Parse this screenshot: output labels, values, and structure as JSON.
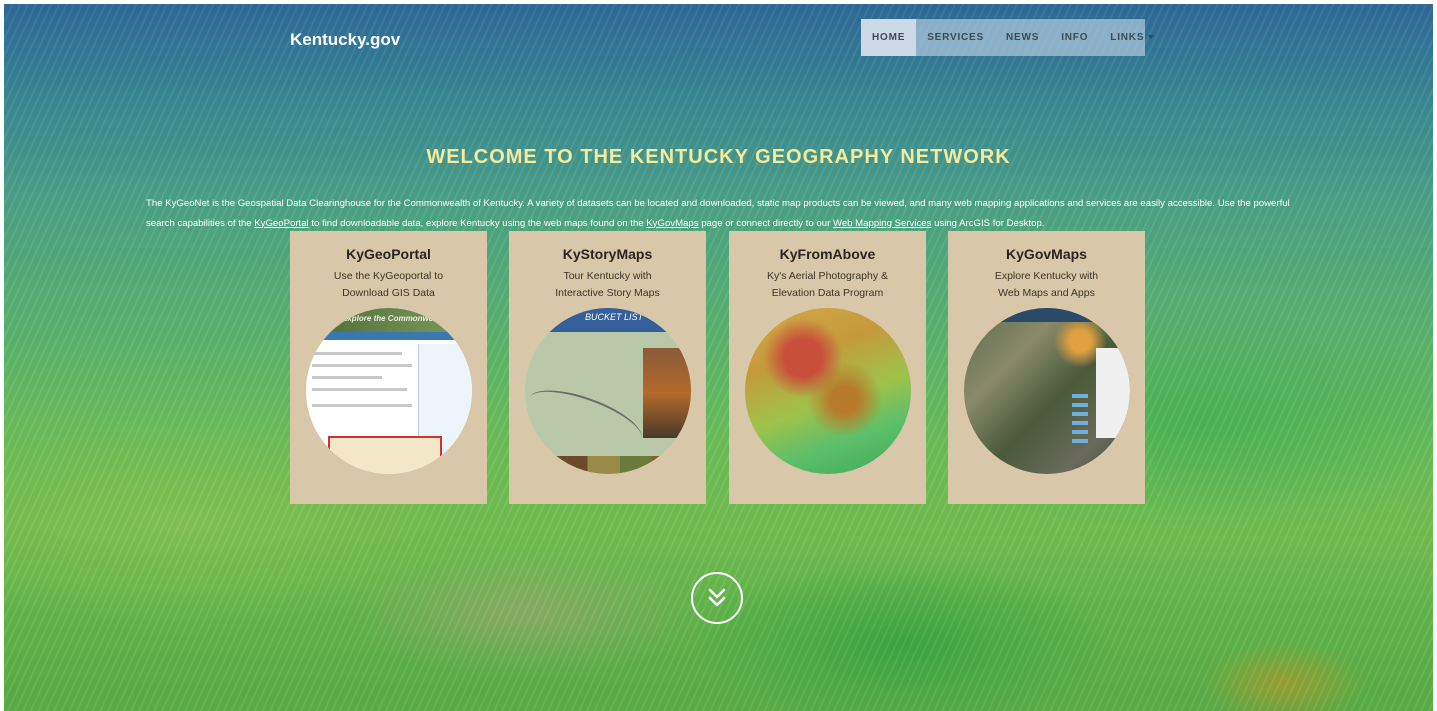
{
  "brand": {
    "name": "Kentucky.gov"
  },
  "nav": {
    "items": [
      {
        "label": "HOME"
      },
      {
        "label": "SERVICES"
      },
      {
        "label": "NEWS"
      },
      {
        "label": "INFO"
      },
      {
        "label": "LINKS"
      }
    ]
  },
  "hero": {
    "headline": "WELCOME TO THE KENTUCKY GEOGRAPHY NETWORK",
    "intro": {
      "part1": "The KyGeoNet is the Geospatial Data Clearinghouse for the Commonwealth of Kentucky. A variety of datasets can be located and downloaded, static map products can be viewed, and many web mapping applications and services are easily accessible. Use the powerful search capabilities of the ",
      "link1": "KyGeoPortal",
      "part2": " to find downloadable data, explore Kentucky using the web maps found on the ",
      "link2": "KyGovMaps",
      "part3": " page or connect directly to our ",
      "link3": "Web Mapping Services",
      "part4": " using ArcGIS for Desktop."
    }
  },
  "cards": [
    {
      "title": "KyGeoPortal",
      "line1": "Use the KyGeoportal to",
      "line2": "Download GIS Data",
      "image": "Explore the Commonwealth!"
    },
    {
      "title": "KyStoryMaps",
      "line1": "Tour Kentucky with",
      "line2": "Interactive Story Maps",
      "image": "BUCKET LIST"
    },
    {
      "title": "KyFromAbove",
      "line1": "Ky's Aerial Photography &",
      "line2": "Elevation Data Program"
    },
    {
      "title": "KyGovMaps",
      "line1": "Explore Kentucky with",
      "line2": "Web Maps and Apps"
    }
  ],
  "icons": {
    "scroll": "double-chevron-down-icon",
    "links_caret": "caret-down-icon"
  }
}
